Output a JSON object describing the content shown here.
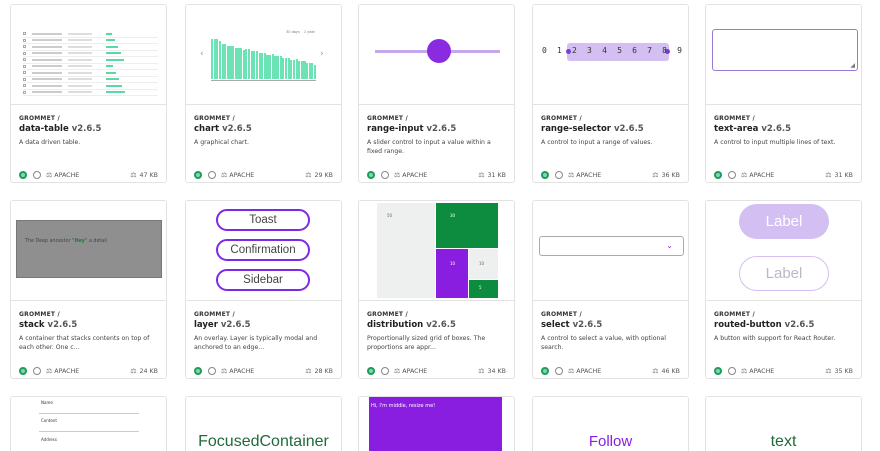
{
  "cards": [
    {
      "scope": "GROMMET /",
      "name": "data-table",
      "version": "v2.6.5",
      "description": "A data driven table.",
      "license": "APACHE",
      "size": "47 KB"
    },
    {
      "scope": "GROMMET /",
      "name": "chart",
      "version": "v2.6.5",
      "description": "A graphical chart.",
      "license": "APACHE",
      "size": "29 KB"
    },
    {
      "scope": "GROMMET /",
      "name": "range-input",
      "version": "v2.6.5",
      "description": "A slider control to input a value within a fixed range.",
      "license": "APACHE",
      "size": "31 KB"
    },
    {
      "scope": "GROMMET /",
      "name": "range-selector",
      "version": "v2.6.5",
      "description": "A control to input a range of values.",
      "license": "APACHE",
      "size": "36 KB"
    },
    {
      "scope": "GROMMET /",
      "name": "text-area",
      "version": "v2.6.5",
      "description": "A control to input multiple lines of text.",
      "license": "APACHE",
      "size": "31 KB"
    },
    {
      "scope": "GROMMET /",
      "name": "stack",
      "version": "v2.6.5",
      "description": "A container that stacks contents on top of each other. One c...",
      "license": "APACHE",
      "size": "24 KB"
    },
    {
      "scope": "GROMMET /",
      "name": "layer",
      "version": "v2.6.5",
      "description": "An overlay. Layer is typically modal and anchored to an edge...",
      "license": "APACHE",
      "size": "28 KB"
    },
    {
      "scope": "GROMMET /",
      "name": "distribution",
      "version": "v2.6.5",
      "description": "Proportionally sized grid of boxes. The proportions are appr...",
      "license": "APACHE",
      "size": "34 KB"
    },
    {
      "scope": "GROMMET /",
      "name": "select",
      "version": "v2.6.5",
      "description": "A control to select a value, with optional search.",
      "license": "APACHE",
      "size": "46 KB"
    },
    {
      "scope": "GROMMET /",
      "name": "routed-button",
      "version": "v2.6.5",
      "description": "A button with support for React Router.",
      "license": "APACHE",
      "size": "35 KB"
    }
  ],
  "previews": {
    "range_selector_numbers": [
      "0",
      "1",
      "2",
      "3",
      "4",
      "5",
      "6",
      "7",
      "8",
      "9"
    ],
    "stack_text": [
      "The Deep ancestor",
      "\"Hey\"",
      "a detail"
    ],
    "layer_buttons": [
      "Toast",
      "Confirmation",
      "Sidebar"
    ],
    "distribution_values": [
      "50",
      "30",
      "10",
      "10",
      "5"
    ],
    "routed_button_labels": [
      "Label",
      "Label"
    ],
    "form_labels": [
      "Name",
      "Content",
      "Address"
    ],
    "focused_container": "FocusedContainer",
    "full_text": "Hi, I'm middle, resize me!",
    "follow": "Follow",
    "text": "text",
    "chart_tabs": [
      "30 days",
      "1 year"
    ]
  },
  "colors": {
    "accent": "#7d2ae8",
    "green": "#1a9e5c",
    "mint": "#6be3b4",
    "lavender": "#d4bff2"
  }
}
